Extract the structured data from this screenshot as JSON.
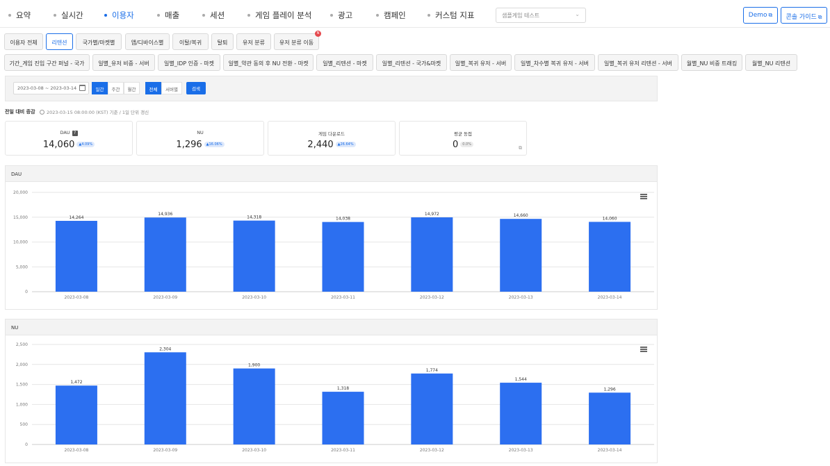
{
  "nav": {
    "items": [
      {
        "label": "요약",
        "active": false
      },
      {
        "label": "실시간",
        "active": false
      },
      {
        "label": "이용자",
        "active": true
      },
      {
        "label": "매출",
        "active": false
      },
      {
        "label": "세션",
        "active": false
      },
      {
        "label": "게임 플레이 분석",
        "active": false
      },
      {
        "label": "광고",
        "active": false
      },
      {
        "label": "캠페인",
        "active": false
      },
      {
        "label": "커스텀 지표",
        "active": false
      }
    ],
    "game_select": "샘플게임 테스트",
    "demo_label": "Demo",
    "guide_label": "콘솔 가이드"
  },
  "tabs_row1": [
    {
      "label": "이용자 전체",
      "active": false
    },
    {
      "label": "리텐션",
      "active": true
    },
    {
      "label": "국가별/마켓별",
      "active": false
    },
    {
      "label": "앱/디바이스별",
      "active": false
    },
    {
      "label": "이탈/복귀",
      "active": false
    },
    {
      "label": "탈퇴",
      "active": false
    },
    {
      "label": "유저 분류",
      "active": false
    },
    {
      "label": "유저 분류 이동",
      "active": false
    }
  ],
  "new_badge": "N",
  "tabs_row2": [
    "기간_게임 진입 구간 퍼널 - 국가",
    "일별_유저 비중 - 서버",
    "일별_IDP 인증 - 마켓",
    "일별_약관 동의 후 NU 전환 - 마켓",
    "일별_리텐션 - 마켓",
    "일별_리텐션 - 국가&마켓",
    "일별_복귀 유저 - 서버",
    "일별_차수별 복귀 유저 - 서버",
    "일별_복귀 유저 리텐션 - 서버",
    "월별_NU 비중 트래킹",
    "월별_NU 리텐션"
  ],
  "filter": {
    "date_range": "2023-03-08 ~ 2023-03-14",
    "period_options": [
      {
        "label": "일간",
        "on": true
      },
      {
        "label": "주간",
        "on": false
      },
      {
        "label": "월간",
        "on": false
      }
    ],
    "scope_options": [
      {
        "label": "전체",
        "on": true
      },
      {
        "label": "서버별",
        "on": false
      }
    ],
    "search_label": "검색"
  },
  "compare": {
    "title": "전일 대비 증감",
    "info": "2023-03-15 08:00:00 (KST) 기준 / 1일 단위 갱신"
  },
  "cards": [
    {
      "label": "DAU",
      "value": "14,060",
      "change": "4.09%",
      "zero": false,
      "help": "?"
    },
    {
      "label": "NU",
      "value": "1,296",
      "change": "16.06%",
      "zero": false
    },
    {
      "label": "게임 다운로드",
      "value": "2,440",
      "change": "26.64%",
      "zero": false
    },
    {
      "label": "평균 동접",
      "value": "0",
      "change": "0.0%",
      "zero": true
    }
  ],
  "chart_data": [
    {
      "type": "bar",
      "title": "DAU",
      "categories": [
        "2023-03-08",
        "2023-03-09",
        "2023-03-10",
        "2023-03-11",
        "2023-03-12",
        "2023-03-13",
        "2023-03-14"
      ],
      "values": [
        14264,
        14936,
        14318,
        14038,
        14972,
        14660,
        14060
      ],
      "ylim": [
        0,
        20000
      ],
      "yticks": [
        "0",
        "5,000",
        "10,000",
        "15,000",
        "20,000"
      ],
      "color": "#2c6ff0",
      "grid": true
    },
    {
      "type": "bar",
      "title": "NU",
      "categories": [
        "2023-03-08",
        "2023-03-09",
        "2023-03-10",
        "2023-03-11",
        "2023-03-12",
        "2023-03-13",
        "2023-03-14"
      ],
      "values": [
        1472,
        2304,
        1900,
        1318,
        1774,
        1544,
        1296
      ],
      "ylim": [
        0,
        2500
      ],
      "yticks": [
        "0",
        "500",
        "1,000",
        "1,500",
        "2,000",
        "2,500"
      ],
      "color": "#2c6ff0",
      "grid": true
    }
  ]
}
